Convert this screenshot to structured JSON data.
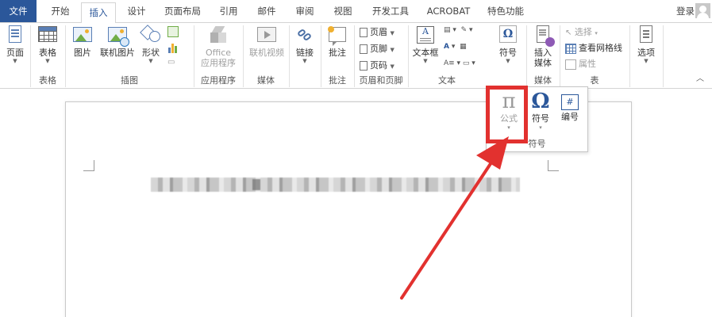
{
  "tabs": {
    "file": "文件",
    "home": "开始",
    "insert": "插入",
    "design": "设计",
    "layout": "页面布局",
    "references": "引用",
    "mailings": "邮件",
    "review": "审阅",
    "view": "视图",
    "developer": "开发工具",
    "acrobat": "ACROBAT",
    "features": "特色功能"
  },
  "account": {
    "signin": "登录"
  },
  "ribbon": {
    "pages": {
      "button": "页面",
      "group": ""
    },
    "tables": {
      "button": "表格",
      "group": "表格"
    },
    "illustrations": {
      "pictures": "图片",
      "online_pictures": "联机图片",
      "shapes": "形状",
      "group": "插图"
    },
    "apps": {
      "office_line1": "Office",
      "office_line2": "应用程序",
      "group": "应用程序"
    },
    "media": {
      "online_video": "联机视频",
      "group": "媒体"
    },
    "links": {
      "button": "链接"
    },
    "comments": {
      "button": "批注",
      "group": "批注"
    },
    "header_footer": {
      "header": "页眉",
      "footer": "页脚",
      "page_number": "页码",
      "group": "页眉和页脚"
    },
    "text": {
      "textbox": "文本框",
      "group": "文本"
    },
    "symbols": {
      "button": "符号"
    },
    "embed_media": {
      "line1": "插入",
      "line2": "媒体",
      "group": "媒体"
    },
    "table_tools": {
      "select": "选择",
      "view_gridlines": "查看网格线",
      "properties": "属性",
      "group": "表"
    },
    "options": {
      "button": "选项"
    }
  },
  "symbols_dropdown": {
    "formula_glyph": "π",
    "formula_label": "公式",
    "symbol_glyph": "Ω",
    "symbol_label": "符号",
    "numbering_glyph": "#",
    "numbering_label": "编号",
    "group": "符号"
  },
  "colors": {
    "file_tab": "#2b579a",
    "accent": "#2b579a",
    "highlight": "#e2312f"
  }
}
